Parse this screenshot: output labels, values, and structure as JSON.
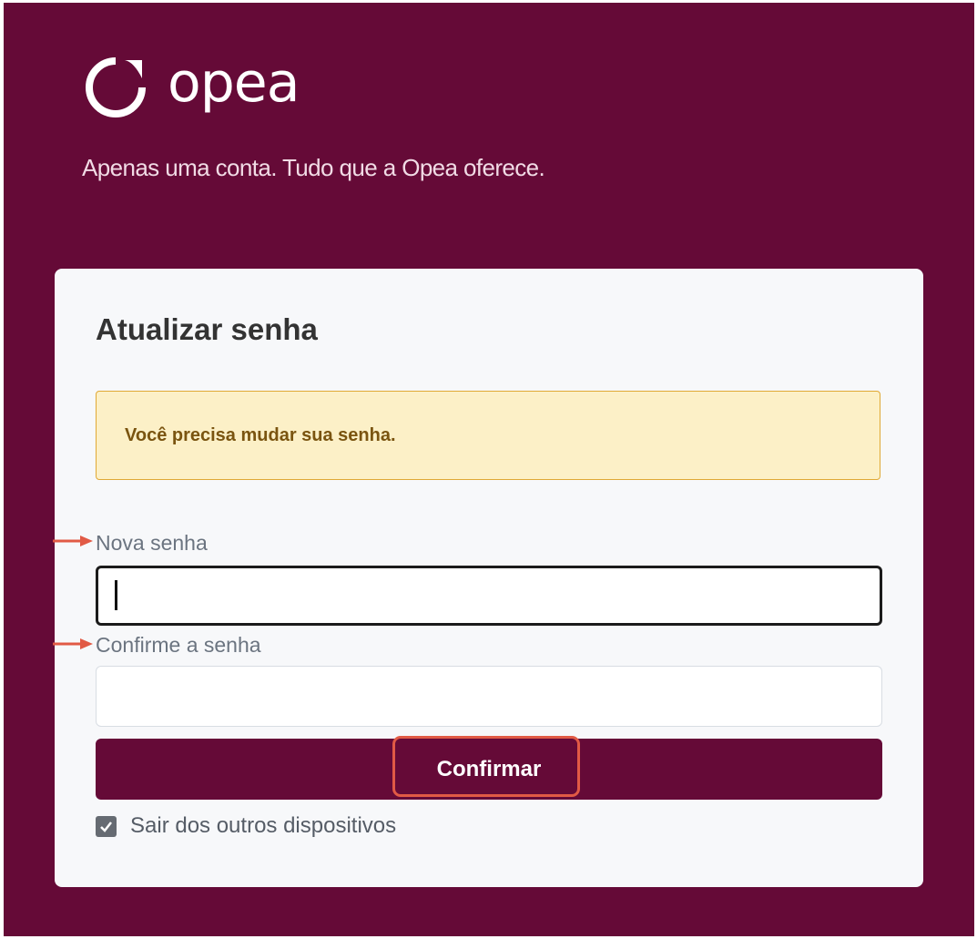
{
  "brand": {
    "logo_icon": "opea-circle-logo-icon",
    "name": "opea",
    "tagline": "Apenas uma conta. Tudo que a Opea oferece."
  },
  "form": {
    "title": "Atualizar senha",
    "alert": "Você precisa mudar sua senha.",
    "new_password": {
      "label": "Nova senha",
      "value": ""
    },
    "confirm_password": {
      "label": "Confirme a senha",
      "value": ""
    },
    "submit_label": "Confirmar",
    "logout_other_devices": {
      "label": "Sair dos outros dispositivos",
      "checked": true
    }
  },
  "annotations": {
    "arrow_icon": "right-arrow-icon",
    "highlight_box": "red-highlight-box"
  },
  "colors": {
    "brand": "#650a37",
    "card_background": "#f7f8fa",
    "alert_background": "#fcf0c7",
    "alert_border": "#e0a935",
    "alert_text": "#7a5410",
    "annotation_red": "#e15a45"
  }
}
